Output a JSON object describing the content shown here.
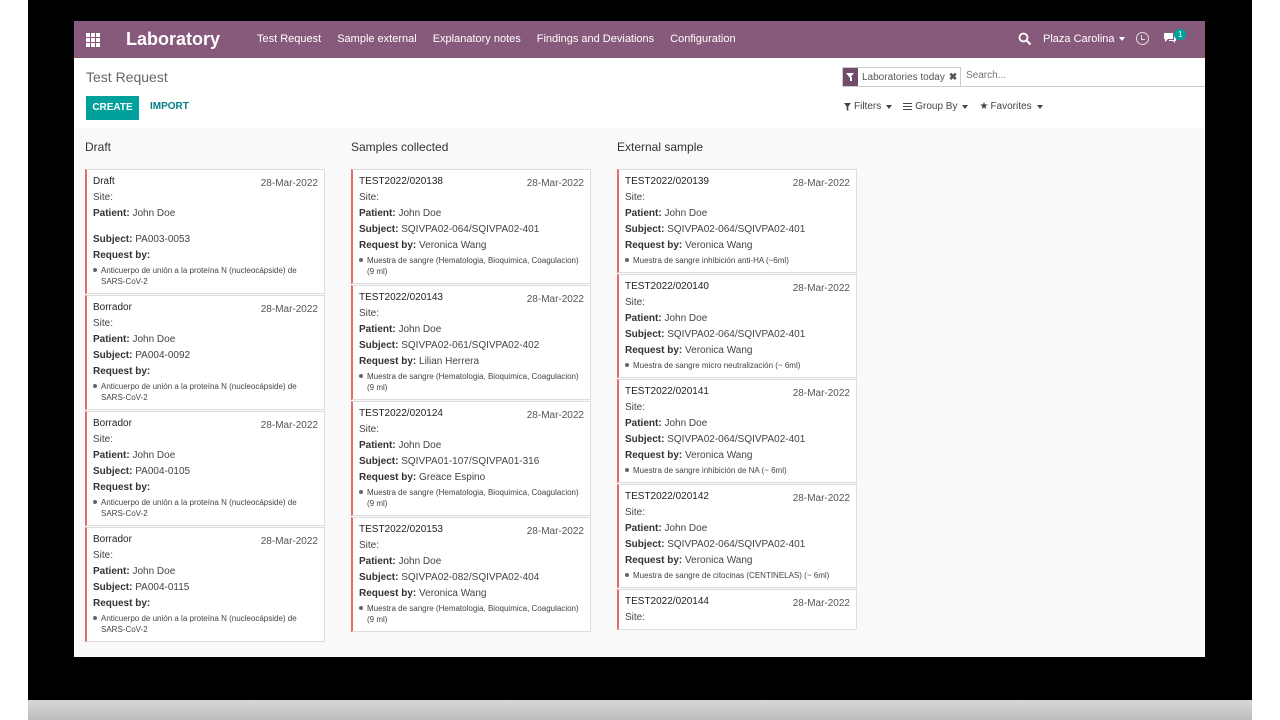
{
  "app": {
    "title": "Laboratory",
    "menu": [
      "Test Request",
      "Sample external",
      "Explanatory notes",
      "Findings and Deviations",
      "Configuration"
    ],
    "company": "Plaza Carolina",
    "message_count": "1"
  },
  "control": {
    "breadcrumb": "Test Request",
    "create_label": "CREATE",
    "import_label": "IMPORT",
    "facet_label": "Laboratories today",
    "facet_remove": "✖",
    "search_placeholder": "Search...",
    "filters_label": "Filters",
    "groupby_label": "Group By",
    "favorites_label": "Favorites"
  },
  "labels": {
    "site": "Site:",
    "patient": "Patient:",
    "subject": "Subject:",
    "request_by": "Request by:"
  },
  "columns": [
    {
      "title": "Draft",
      "cards": [
        {
          "name": "Draft",
          "date": "28-Mar-2022",
          "patient": "John Doe",
          "subject": "PA003-0053",
          "request_by": "",
          "detail": "Anticuerpo de unión a la proteína N (nucleocápside) de SARS-CoV-2",
          "gap": true
        },
        {
          "name": "Borrador",
          "date": "28-Mar-2022",
          "patient": "John Doe",
          "subject": "PA004-0092",
          "request_by": "",
          "detail": "Anticuerpo de unión a la proteína N (nucleocápside) de SARS-CoV-2",
          "gap": false
        },
        {
          "name": "Borrador",
          "date": "28-Mar-2022",
          "patient": "John Doe",
          "subject": "PA004-0105",
          "request_by": "",
          "detail": "Anticuerpo de unión a la proteína N (nucleocápside) de SARS-CoV-2",
          "gap": false
        },
        {
          "name": "Borrador",
          "date": "28-Mar-2022",
          "patient": "John Doe",
          "subject": "PA004-0115",
          "request_by": "",
          "detail": "Anticuerpo de unión a la proteína N (nucleocápside) de SARS-CoV-2",
          "gap": false
        }
      ]
    },
    {
      "title": "Samples collected",
      "cards": [
        {
          "name": "TEST2022/020138",
          "date": "28-Mar-2022",
          "patient": "John Doe",
          "subject": "SQIVPA02-064/SQIVPA02-401",
          "request_by": "Veronica Wang",
          "detail": "Muestra de sangre (Hematologia, Bioquimica, Coagulacion) (9 ml)",
          "gap": false
        },
        {
          "name": "TEST2022/020143",
          "date": "28-Mar-2022",
          "patient": "John Doe",
          "subject": "SQIVPA02-061/SQIVPA02-402",
          "request_by": "Lilian Herrera",
          "detail": "Muestra de sangre (Hematologia, Bioquimica, Coagulacion) (9 ml)",
          "gap": false
        },
        {
          "name": "TEST2022/020124",
          "date": "28-Mar-2022",
          "patient": "John Doe",
          "subject": "SQIVPA01-107/SQIVPA01-316",
          "request_by": "Greace Espino",
          "detail": "Muestra de sangre (Hematologia, Bioquimica, Coagulacion) (9 ml)",
          "gap": false
        },
        {
          "name": "TEST2022/020153",
          "date": "28-Mar-2022",
          "patient": "John Doe",
          "subject": "SQIVPA02-082/SQIVPA02-404",
          "request_by": "Veronica Wang",
          "detail": "Muestra de sangre (Hematologia, Bioquimica, Coagulacion) (9 ml)",
          "gap": false
        }
      ]
    },
    {
      "title": "External sample",
      "cards": [
        {
          "name": "TEST2022/020139",
          "date": "28-Mar-2022",
          "patient": "John Doe",
          "subject": "SQIVPA02-064/SQIVPA02-401",
          "request_by": "Veronica Wang",
          "detail": "Muestra de sangre inhibición anti-HA (~6ml)",
          "gap": false
        },
        {
          "name": "TEST2022/020140",
          "date": "28-Mar-2022",
          "patient": "John Doe",
          "subject": "SQIVPA02-064/SQIVPA02-401",
          "request_by": "Veronica Wang",
          "detail": "Muestra de sangre micro neutralización (~ 6ml)",
          "gap": false
        },
        {
          "name": "TEST2022/020141",
          "date": "28-Mar-2022",
          "patient": "John Doe",
          "subject": "SQIVPA02-064/SQIVPA02-401",
          "request_by": "Veronica Wang",
          "detail": "Muestra de sangre inhibición de NA (~ 6ml)",
          "gap": false
        },
        {
          "name": "TEST2022/020142",
          "date": "28-Mar-2022",
          "patient": "John Doe",
          "subject": "SQIVPA02-064/SQIVPA02-401",
          "request_by": "Veronica Wang",
          "detail": "Muestra de sangre de citocinas (CENTINELAS) (~ 6ml)",
          "gap": false
        },
        {
          "name": "TEST2022/020144",
          "date": "28-Mar-2022",
          "patient": "",
          "subject": "",
          "request_by": "",
          "detail": "",
          "gap": false
        }
      ]
    }
  ]
}
